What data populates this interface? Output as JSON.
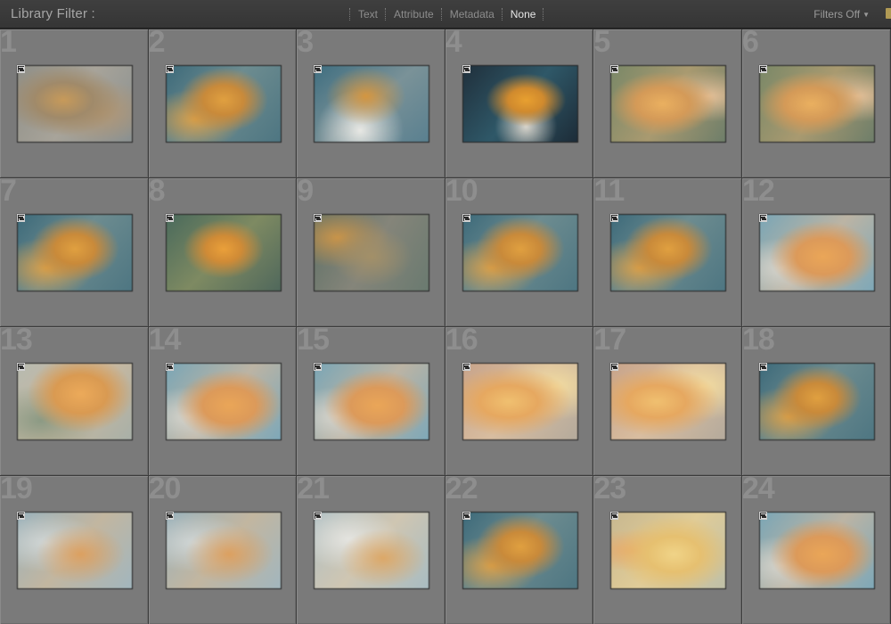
{
  "filter_bar": {
    "title": "Library Filter :",
    "modes": [
      "Text",
      "Attribute",
      "Metadata",
      "None"
    ],
    "active_mode": "None",
    "filters_status": "Filters Off"
  },
  "thumbnail_badge_icon": "develop-adjustments-icon",
  "photos": [
    {
      "number": "1",
      "tone": "muted-gray-orange"
    },
    {
      "number": "2",
      "tone": "blue-orange"
    },
    {
      "number": "3",
      "tone": "blue-orange-white"
    },
    {
      "number": "4",
      "tone": "dark-blue-orange"
    },
    {
      "number": "5",
      "tone": "orange-green"
    },
    {
      "number": "6",
      "tone": "orange-green"
    },
    {
      "number": "7",
      "tone": "blue-orange"
    },
    {
      "number": "8",
      "tone": "green-orange-burst"
    },
    {
      "number": "9",
      "tone": "muted-green-orange"
    },
    {
      "number": "10",
      "tone": "blue-orange"
    },
    {
      "number": "11",
      "tone": "blue-orange"
    },
    {
      "number": "12",
      "tone": "light-blue-orange"
    },
    {
      "number": "13",
      "tone": "light-orange-blur"
    },
    {
      "number": "14",
      "tone": "light-blue-orange"
    },
    {
      "number": "15",
      "tone": "light-blue-orange"
    },
    {
      "number": "16",
      "tone": "orange-yellow-soft"
    },
    {
      "number": "17",
      "tone": "orange-yellow-soft"
    },
    {
      "number": "18",
      "tone": "blue-orange"
    },
    {
      "number": "19",
      "tone": "pale-blue-orange"
    },
    {
      "number": "20",
      "tone": "pale-blue-orange"
    },
    {
      "number": "21",
      "tone": "pale-white-orange"
    },
    {
      "number": "22",
      "tone": "blue-orange"
    },
    {
      "number": "23",
      "tone": "yellow-pale"
    },
    {
      "number": "24",
      "tone": "light-blue-orange"
    }
  ]
}
